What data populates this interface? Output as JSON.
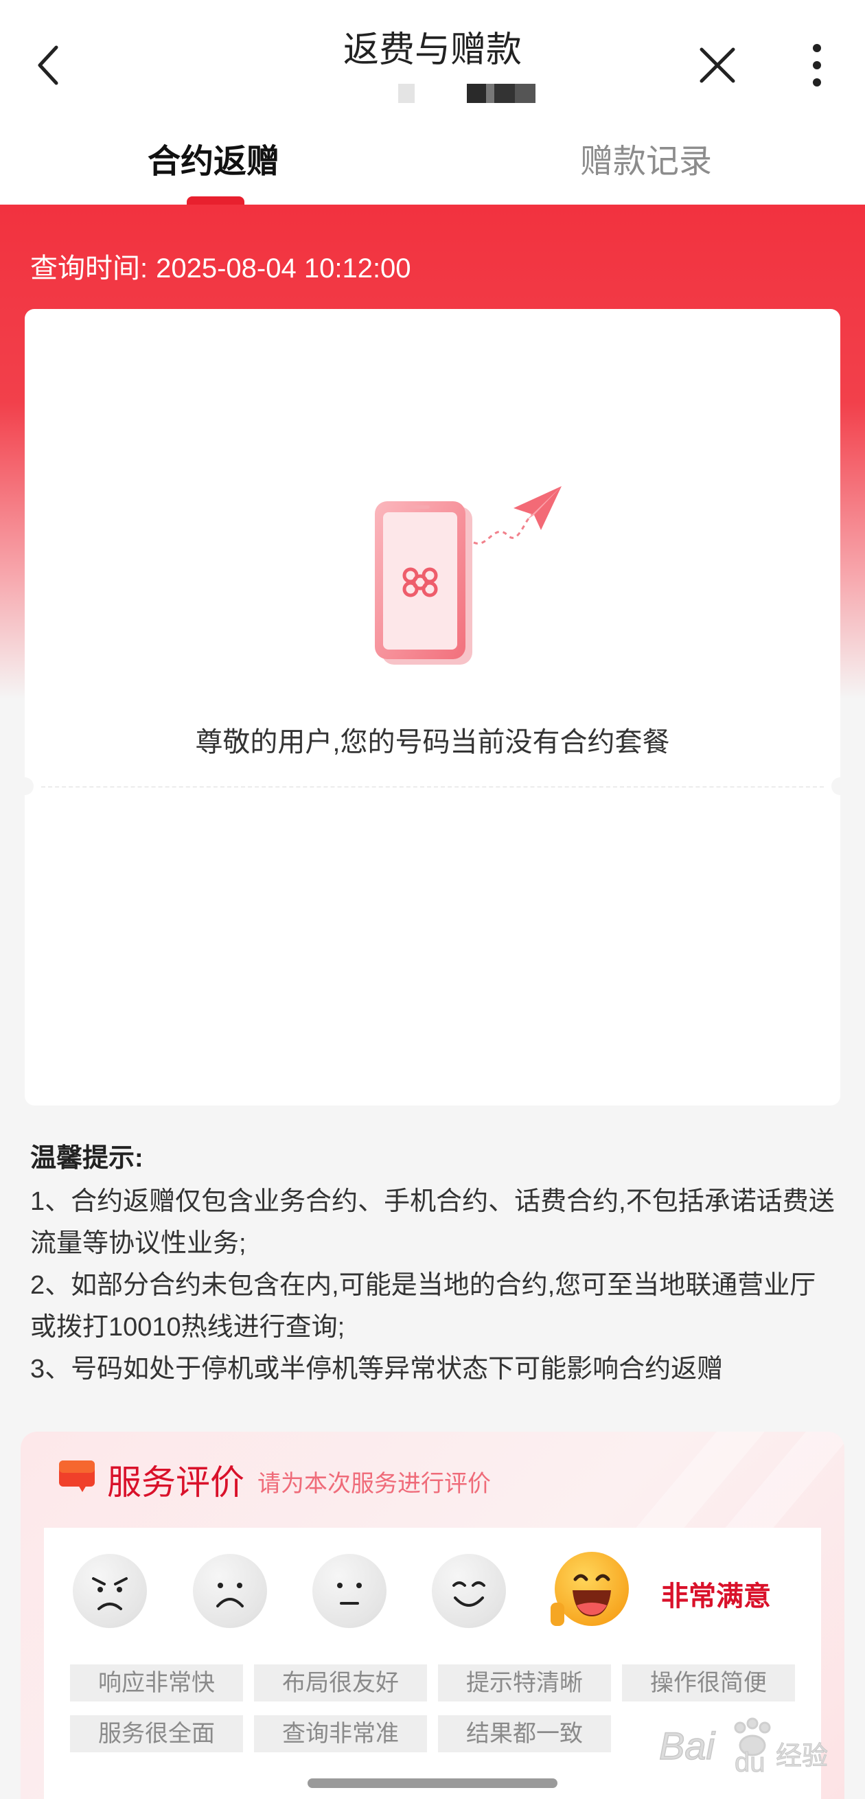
{
  "header": {
    "title": "返费与赠款",
    "tabs": [
      {
        "label": "合约返赠",
        "active": true
      },
      {
        "label": "赠款记录",
        "active": false
      }
    ]
  },
  "query": {
    "label": "查询时间:",
    "value": "2025-08-04 10:12:00"
  },
  "empty_state": {
    "message": "尊敬的用户,您的号码当前没有合约套餐",
    "illustration": "phone-with-paper-plane-icon"
  },
  "tips": {
    "title": "温馨提示:",
    "items": [
      "1、合约返赠仅包含业务合约、手机合约、话费合约,不包括承诺话费送流量等协议性业务;",
      "2、如部分合约未包含在内,可能是当地的合约,您可至当地联通营业厅或拨打10010热线进行查询;",
      "3、号码如处于停机或半停机等异常状态下可能影响合约返赠"
    ]
  },
  "evaluation": {
    "title": "服务评价",
    "subtitle": "请为本次服务进行评价",
    "selected_label": "非常满意",
    "tags": [
      "响应非常快",
      "布局很友好",
      "提示特清晰",
      "操作很简便",
      "服务很全面",
      "查询非常准",
      "结果都一致"
    ]
  },
  "colors": {
    "brand_red": "#e8202e",
    "eval_red": "#d9112a"
  }
}
